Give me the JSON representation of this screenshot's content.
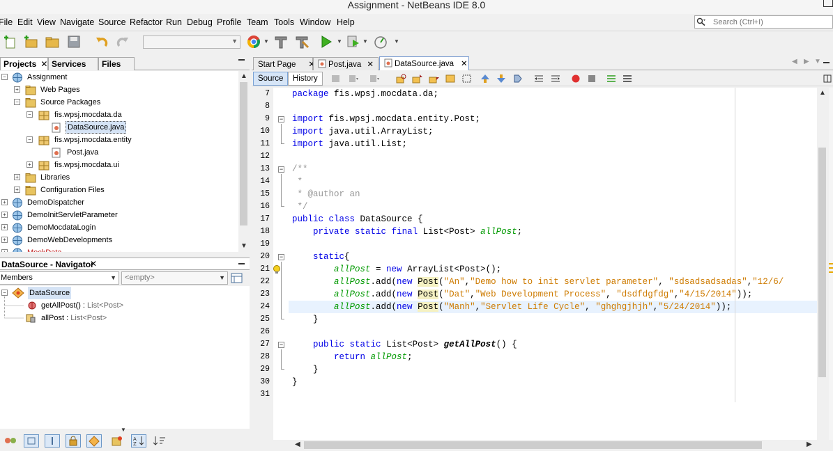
{
  "window": {
    "title": "Assignment - NetBeans IDE 8.0"
  },
  "menu": [
    "File",
    "Edit",
    "View",
    "Navigate",
    "Source",
    "Refactor",
    "Run",
    "Debug",
    "Profile",
    "Team",
    "Tools",
    "Window",
    "Help"
  ],
  "search": {
    "placeholder": "Search (Ctrl+I)"
  },
  "left_tabs": [
    "Projects",
    "Services",
    "Files"
  ],
  "project_tree": [
    {
      "label": "Assignment",
      "icon": "project-icon"
    },
    {
      "label": "Web Pages",
      "icon": "folder-icon"
    },
    {
      "label": "Source Packages",
      "icon": "folder-icon"
    },
    {
      "label": "fis.wpsj.mocdata.da",
      "icon": "package-icon"
    },
    {
      "label": "DataSource.java",
      "icon": "java-file-icon"
    },
    {
      "label": "fis.wpsj.mocdata.entity",
      "icon": "package-icon"
    },
    {
      "label": "Post.java",
      "icon": "java-file-icon"
    },
    {
      "label": "fis.wpsj.mocdata.ui",
      "icon": "package-icon"
    },
    {
      "label": "Libraries",
      "icon": "folder-icon"
    },
    {
      "label": "Configuration Files",
      "icon": "folder-icon"
    },
    {
      "label": "DemoDispatcher",
      "icon": "project-icon"
    },
    {
      "label": "DemoInitServletParameter",
      "icon": "project-icon"
    },
    {
      "label": "DemoMocdataLogin",
      "icon": "project-icon"
    },
    {
      "label": "DemoWebDevelopments",
      "icon": "project-icon"
    },
    {
      "label": "MockData",
      "icon": "project-icon"
    }
  ],
  "navigator": {
    "title": "DataSource - Navigator",
    "filter": "Members",
    "empty": "<empty>",
    "class_name": "DataSource",
    "members": [
      {
        "name": "getAllPost()",
        "sep": " : ",
        "type": "List<Post>",
        "icon": "method-icon"
      },
      {
        "name": "allPost",
        "sep": " : ",
        "type": "List<Post>",
        "icon": "field-icon"
      }
    ]
  },
  "editor": {
    "tabs": [
      "Start Page",
      "Post.java",
      "DataSource.java"
    ],
    "active_tab": "DataSource.java",
    "view_tabs": [
      "Source",
      "History"
    ],
    "first_line": 7,
    "current_line": 24,
    "code_lines": [
      "package fis.wpsj.mocdata.da;",
      "",
      "import fis.wpsj.mocdata.entity.Post;",
      "import java.util.ArrayList;",
      "import java.util.List;",
      "",
      "/**",
      " *",
      " * @author an",
      " */",
      "public class DataSource {",
      "    private static final List<Post> allPost;",
      "",
      "    static{",
      "        allPost = new ArrayList<Post>();",
      "        allPost.add(new Post(\"An\",\"Demo how to init servlet parameter\", \"sdsadsadsadas\",\"12/6/",
      "        allPost.add(new Post(\"Dat\",\"Web Development Process\", \"dsdfdgfdg\",\"4/15/2014\"));",
      "        allPost.add(new Post(\"Manh\",\"Servlet Life Cycle\", \"ghghgjhjh\",\"5/24/2014\"));",
      "    }",
      "",
      "    public static List<Post> getAllPost() {",
      "        return allPost;",
      "    }",
      "}",
      ""
    ]
  }
}
